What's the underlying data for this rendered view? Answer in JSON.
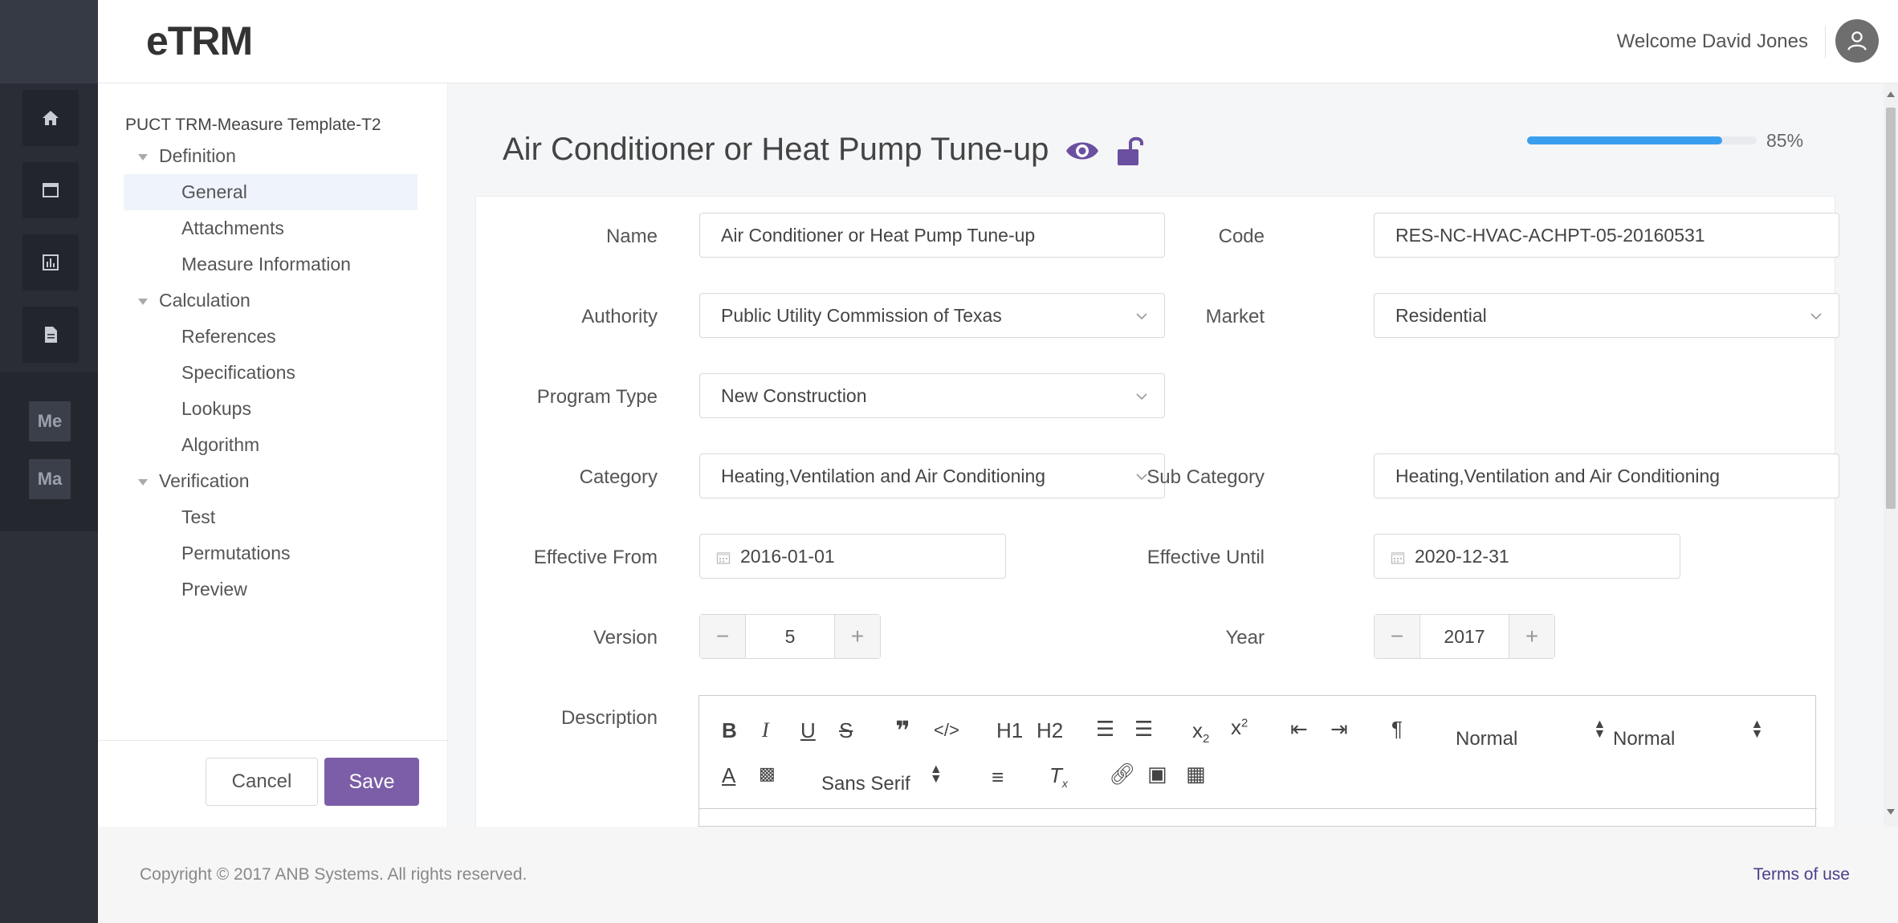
{
  "app": {
    "logo": "eTRM"
  },
  "header": {
    "welcome": "Welcome David Jones"
  },
  "rail": {
    "tags": [
      "Me",
      "Ma"
    ]
  },
  "tree": {
    "root": "PUCT TRM-Measure Template-T2",
    "groups": [
      {
        "label": "Definition",
        "items": [
          "General",
          "Attachments",
          "Measure Information"
        ]
      },
      {
        "label": "Calculation",
        "items": [
          "References",
          "Specifications",
          "Lookups",
          "Algorithm"
        ]
      },
      {
        "label": "Verification",
        "items": [
          "Test",
          "Permutations",
          "Preview"
        ]
      }
    ],
    "selected": "General",
    "cancel_label": "Cancel",
    "save_label": "Save"
  },
  "main": {
    "title": "Air Conditioner or Heat Pump Tune-up",
    "progress": {
      "value": 85,
      "label": "85%"
    },
    "form": {
      "name": {
        "label": "Name",
        "value": "Air Conditioner or Heat Pump Tune-up"
      },
      "code": {
        "label": "Code",
        "value": "RES-NC-HVAC-ACHPT-05-20160531"
      },
      "authority": {
        "label": "Authority",
        "value": "Public Utility Commission of Texas"
      },
      "market": {
        "label": "Market",
        "value": "Residential"
      },
      "program_type": {
        "label": "Program Type",
        "value": "New Construction"
      },
      "category": {
        "label": "Category",
        "value": "Heating,Ventilation and Air Conditioning"
      },
      "sub_category": {
        "label": "Sub Category",
        "value": "Heating,Ventilation and Air Conditioning"
      },
      "effective_from": {
        "label": "Effective From",
        "value": "2016-01-01"
      },
      "effective_until": {
        "label": "Effective Until",
        "value": "2020-12-31"
      },
      "version": {
        "label": "Version",
        "value": "5",
        "minus": "−",
        "plus": "+"
      },
      "year": {
        "label": "Year",
        "value": "2017",
        "minus": "−",
        "plus": "+"
      },
      "description": {
        "label": "Description"
      }
    },
    "editor_toolbar": {
      "header_select": "Normal",
      "size_select": "Normal",
      "font_select": "Sans Serif",
      "h1": "H1",
      "h2": "H2"
    }
  },
  "footer": {
    "copyright": "Copyright © 2017 ANB Systems. All rights reserved.",
    "terms": "Terms of use"
  },
  "colors": {
    "accent": "#7b5ea7",
    "progress": "#3a9ef0",
    "rail": "#2d3038"
  }
}
